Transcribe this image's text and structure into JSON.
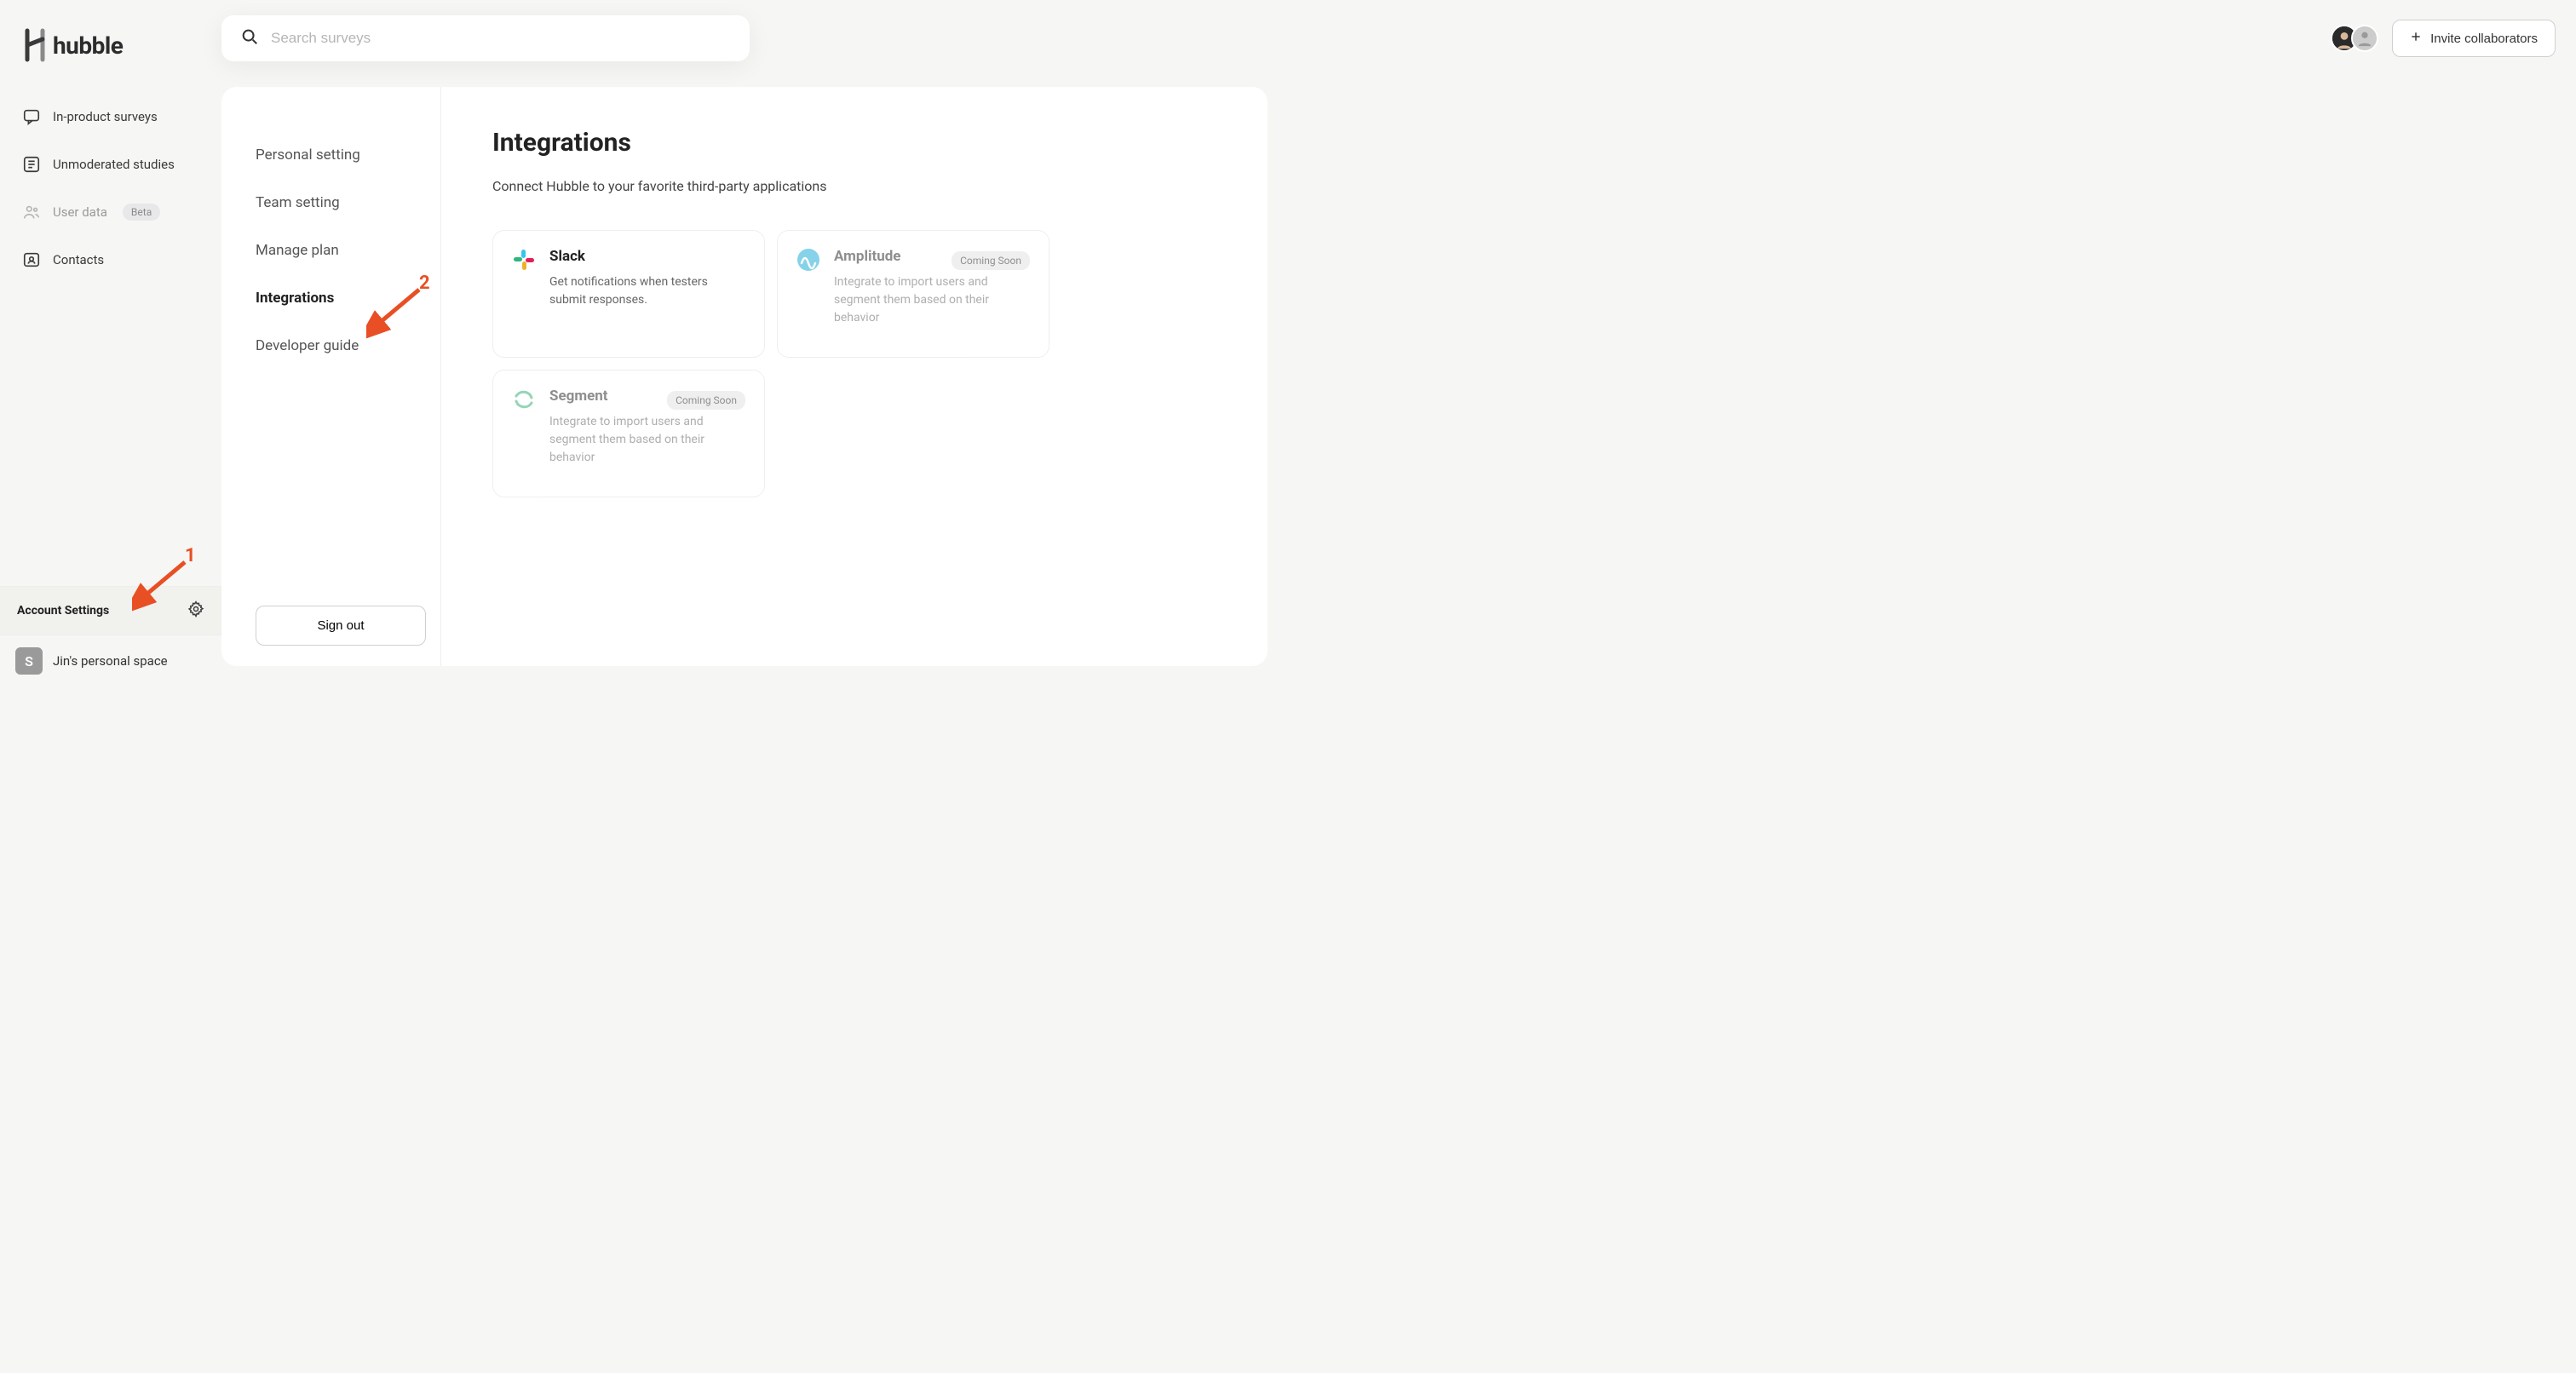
{
  "brand": {
    "name": "hubble"
  },
  "search": {
    "placeholder": "Search surveys"
  },
  "invite": {
    "label": "Invite collaborators"
  },
  "sidebar": {
    "items": [
      {
        "label": "In-product surveys"
      },
      {
        "label": "Unmoderated studies"
      },
      {
        "label": "User data",
        "badge": "Beta"
      },
      {
        "label": "Contacts"
      }
    ],
    "account": {
      "label": "Account Settings"
    },
    "workspace": {
      "initial": "S",
      "name": "Jin's personal space"
    }
  },
  "settings_nav": {
    "items": [
      {
        "label": "Personal setting"
      },
      {
        "label": "Team setting"
      },
      {
        "label": "Manage plan"
      },
      {
        "label": "Integrations",
        "active": true
      },
      {
        "label": "Developer guide"
      }
    ],
    "signout": "Sign out"
  },
  "page": {
    "title": "Integrations",
    "subtitle": "Connect Hubble to your favorite third-party applications"
  },
  "integrations": [
    {
      "name": "Slack",
      "desc": "Get notifications when testers submit responses.",
      "icon": "slack"
    },
    {
      "name": "Amplitude",
      "desc": "Integrate to import users and segment them based on their behavior",
      "icon": "amplitude",
      "badge": "Coming Soon"
    },
    {
      "name": "Segment",
      "desc": "Integrate to import users and segment them based on their behavior",
      "icon": "segment",
      "badge": "Coming Soon"
    }
  ],
  "annotations": {
    "arrow1_num": "1",
    "arrow2_num": "2"
  }
}
